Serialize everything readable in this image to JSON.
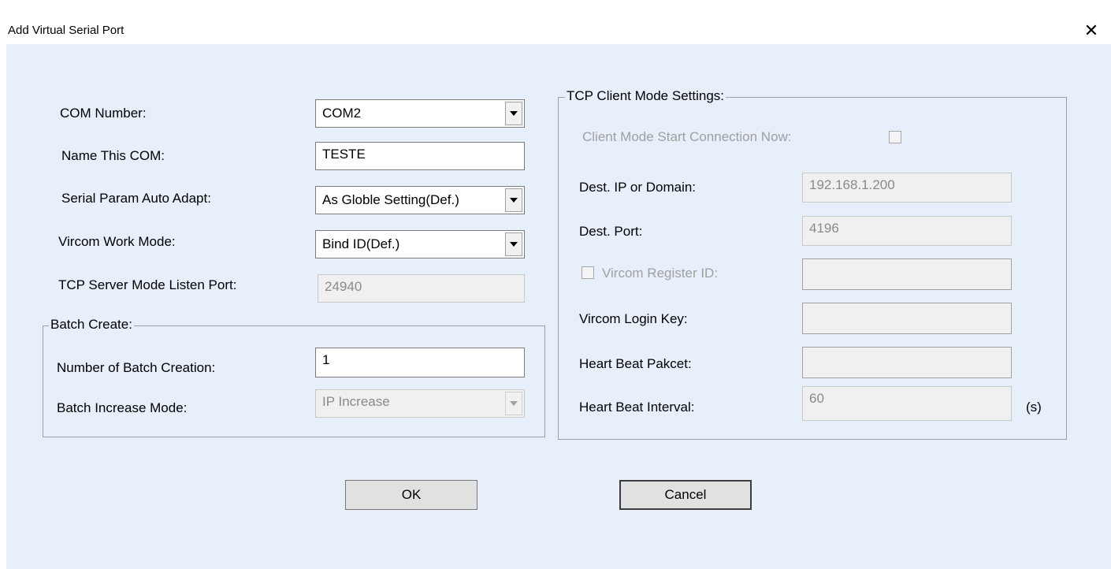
{
  "window": {
    "title": "Add Virtual Serial Port"
  },
  "left": {
    "com_number": {
      "label": "COM Number:",
      "value": "COM2"
    },
    "name_com": {
      "label": "Name This COM:",
      "value": "TESTE"
    },
    "serial_auto": {
      "label": "Serial Param Auto Adapt:",
      "value": "As Globle Setting(Def.)"
    },
    "work_mode": {
      "label": "Vircom Work Mode:",
      "value": "Bind ID(Def.)"
    },
    "listen_port": {
      "label": "TCP Server Mode Listen Port:",
      "value": "24940"
    }
  },
  "batch": {
    "legend": "Batch Create:",
    "number": {
      "label": "Number of Batch Creation:",
      "value": "1"
    },
    "mode": {
      "label": "Batch Increase Mode:",
      "value": "IP Increase"
    }
  },
  "tcp": {
    "legend": "TCP Client Mode Settings:",
    "start_now": {
      "label": "Client Mode Start Connection Now:",
      "checked": false
    },
    "dest_ip": {
      "label": "Dest. IP or Domain:",
      "value": "192.168.1.200"
    },
    "dest_port": {
      "label": "Dest. Port:",
      "value": "4196"
    },
    "register_id": {
      "label": "Vircom Register ID:",
      "checked": false,
      "value": ""
    },
    "login_key": {
      "label": "Vircom Login Key:",
      "value": ""
    },
    "heart_packet": {
      "label": "Heart Beat Pakcet:",
      "value": ""
    },
    "heart_interval": {
      "label": "Heart Beat Interval:",
      "value": "60",
      "unit": "(s)"
    }
  },
  "buttons": {
    "ok": "OK",
    "cancel": "Cancel"
  }
}
